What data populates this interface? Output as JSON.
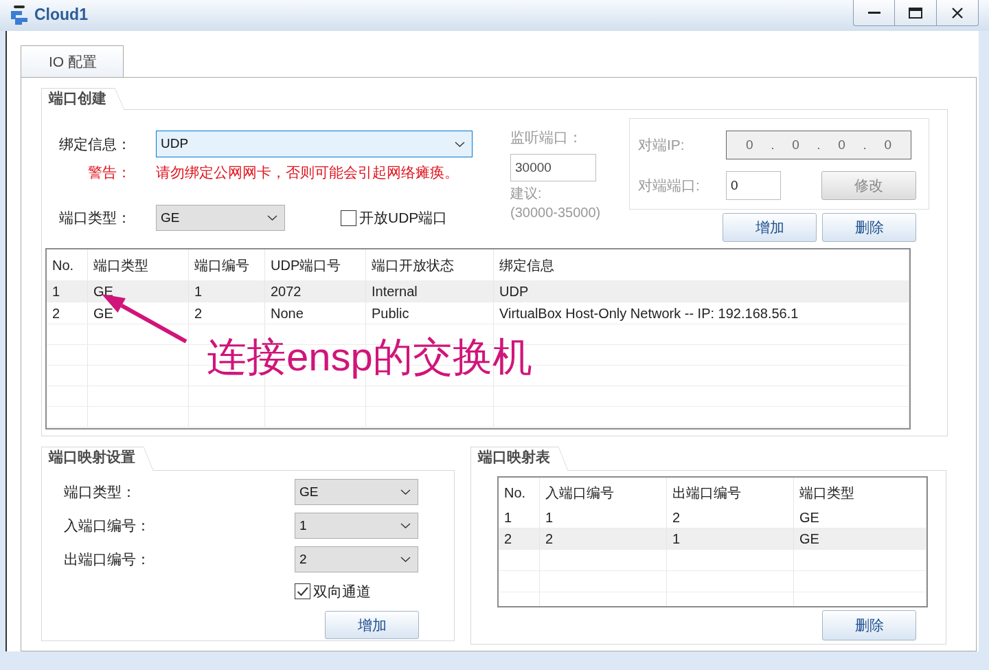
{
  "window": {
    "title": "Cloud1"
  },
  "tabs": [
    {
      "label": "IO 配置",
      "selected": true
    }
  ],
  "port_creation": {
    "title": "端口创建",
    "binding": {
      "label": "绑定信息：",
      "value": "UDP",
      "focused": true
    },
    "warning": {
      "label": "警告：",
      "text": "请勿绑定公网网卡，否则可能会引起网络瘫痪。"
    },
    "port_type": {
      "label": "端口类型：",
      "value": "GE"
    },
    "open_udp": {
      "label": "开放UDP端口",
      "checked": false
    },
    "listen_port": {
      "label": "监听端口：",
      "value": "30000",
      "hint": "建议:",
      "range": "(30000-35000)",
      "disabled": true
    },
    "peer": {
      "disabled": true,
      "ip_label": "对端IP:",
      "ip_parts": [
        "0",
        ".",
        "0",
        ".",
        "0",
        ".",
        "0"
      ],
      "port_label": "对端端口:",
      "port": "0",
      "modify_button": "修改"
    },
    "buttons": [
      "增加",
      "删除"
    ],
    "table": {
      "columns": [
        "No.",
        "端口类型",
        "端口编号",
        "UDP端口号",
        "端口开放状态",
        "绑定信息"
      ],
      "rows": [
        {
          "selected": true,
          "cells": [
            "1",
            "GE",
            "1",
            "2072",
            "Internal",
            "UDP"
          ]
        },
        {
          "selected": false,
          "cells": [
            "2",
            "GE",
            "2",
            "None",
            "Public",
            "VirtualBox Host-Only Network -- IP: 192.168.56.1"
          ]
        }
      ]
    },
    "annotation": {
      "text": "连接ensp的交换机"
    }
  },
  "mapping_settings": {
    "title": "端口映射设置",
    "fields": [
      {
        "label": "端口类型：",
        "value": "GE"
      },
      {
        "label": "入端口编号：",
        "value": "1"
      },
      {
        "label": "出端口编号：",
        "value": "2"
      }
    ],
    "bidirectional": {
      "label": "双向通道",
      "checked": true
    },
    "button": "增加"
  },
  "mapping_table": {
    "title": "端口映射表",
    "columns": [
      "No.",
      "入端口编号",
      "出端口编号",
      "端口类型"
    ],
    "rows": [
      {
        "selected": false,
        "cells": [
          "1",
          "1",
          "2",
          "GE"
        ]
      },
      {
        "selected": true,
        "cells": [
          "2",
          "2",
          "1",
          "GE"
        ]
      }
    ],
    "button": "删除"
  }
}
